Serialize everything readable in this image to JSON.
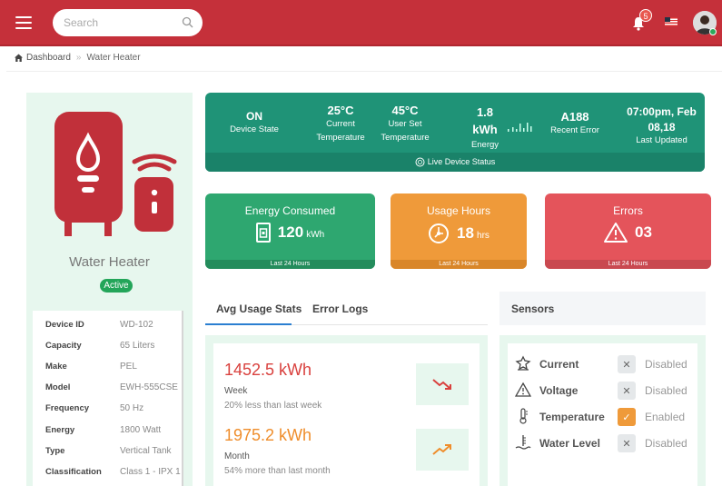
{
  "header": {
    "search_placeholder": "Search",
    "notification_count": "5"
  },
  "breadcrumb": {
    "home": "Dashboard",
    "separator": "»",
    "current": "Water Heater"
  },
  "device": {
    "name": "Water Heater",
    "status": "Active",
    "specs": [
      {
        "key": "Device ID",
        "value": "WD-102"
      },
      {
        "key": "Capacity",
        "value": "65 Liters"
      },
      {
        "key": "Make",
        "value": "PEL"
      },
      {
        "key": "Model",
        "value": "EWH-555CSE"
      },
      {
        "key": "Frequency",
        "value": "50 Hz"
      },
      {
        "key": "Energy",
        "value": "1800 Watt"
      },
      {
        "key": "Type",
        "value": "Vertical Tank"
      },
      {
        "key": "Classification",
        "value": "Class 1 - IPX 1"
      }
    ]
  },
  "status_bar": {
    "device_state": {
      "value": "ON",
      "label": "Device State"
    },
    "current_temp": {
      "value": "25°C",
      "label_1": "Current",
      "label_2": "Temperature"
    },
    "user_temp": {
      "value": "45°C",
      "label_1": "User Set",
      "label_2": "Temperature"
    },
    "energy": {
      "value": "1.8",
      "unit": "kWh",
      "label": "Energy"
    },
    "error": {
      "value": "A188",
      "label": "Recent Error"
    },
    "updated": {
      "line_1": "07:00pm, Feb",
      "line_2": "08,18",
      "label": "Last Updated"
    },
    "footer": "Live Device Status"
  },
  "cards": {
    "energy": {
      "title": "Energy Consumed",
      "value": "120",
      "unit": "kWh",
      "footer": "Last 24 Hours"
    },
    "usage": {
      "title": "Usage Hours",
      "value": "18",
      "unit": "hrs",
      "footer": "Last 24 Hours"
    },
    "errors": {
      "title": "Errors",
      "value": "03",
      "footer": "Last 24 Hours"
    }
  },
  "tabs": {
    "avg_usage": "Avg Usage Stats",
    "error_logs": "Error Logs"
  },
  "usage": {
    "week": {
      "value": "1452.5 kWh",
      "label": "Week",
      "sub": "20% less than last week",
      "trend": "down"
    },
    "month": {
      "value": "1975.2 kWh",
      "label": "Month",
      "sub": "54% more than last month",
      "trend": "up"
    }
  },
  "sensors": {
    "title": "Sensors",
    "items": [
      {
        "name": "Current",
        "status": "Disabled",
        "icon": "current-icon"
      },
      {
        "name": "Voltage",
        "status": "Disabled",
        "icon": "voltage-icon"
      },
      {
        "name": "Temperature",
        "status": "Enabled",
        "icon": "thermometer-icon"
      },
      {
        "name": "Water Level",
        "status": "Disabled",
        "icon": "water-level-icon"
      }
    ]
  },
  "colors": {
    "header": "#c5303a",
    "teal": "#1f9377",
    "green": "#2ea770",
    "orange": "#ef9a3a",
    "red": "#e4545b",
    "device_red": "#c1303a",
    "panel_bg": "#e7f7ee",
    "week_value": "#d9413e",
    "month_value": "#ef8d2b"
  }
}
